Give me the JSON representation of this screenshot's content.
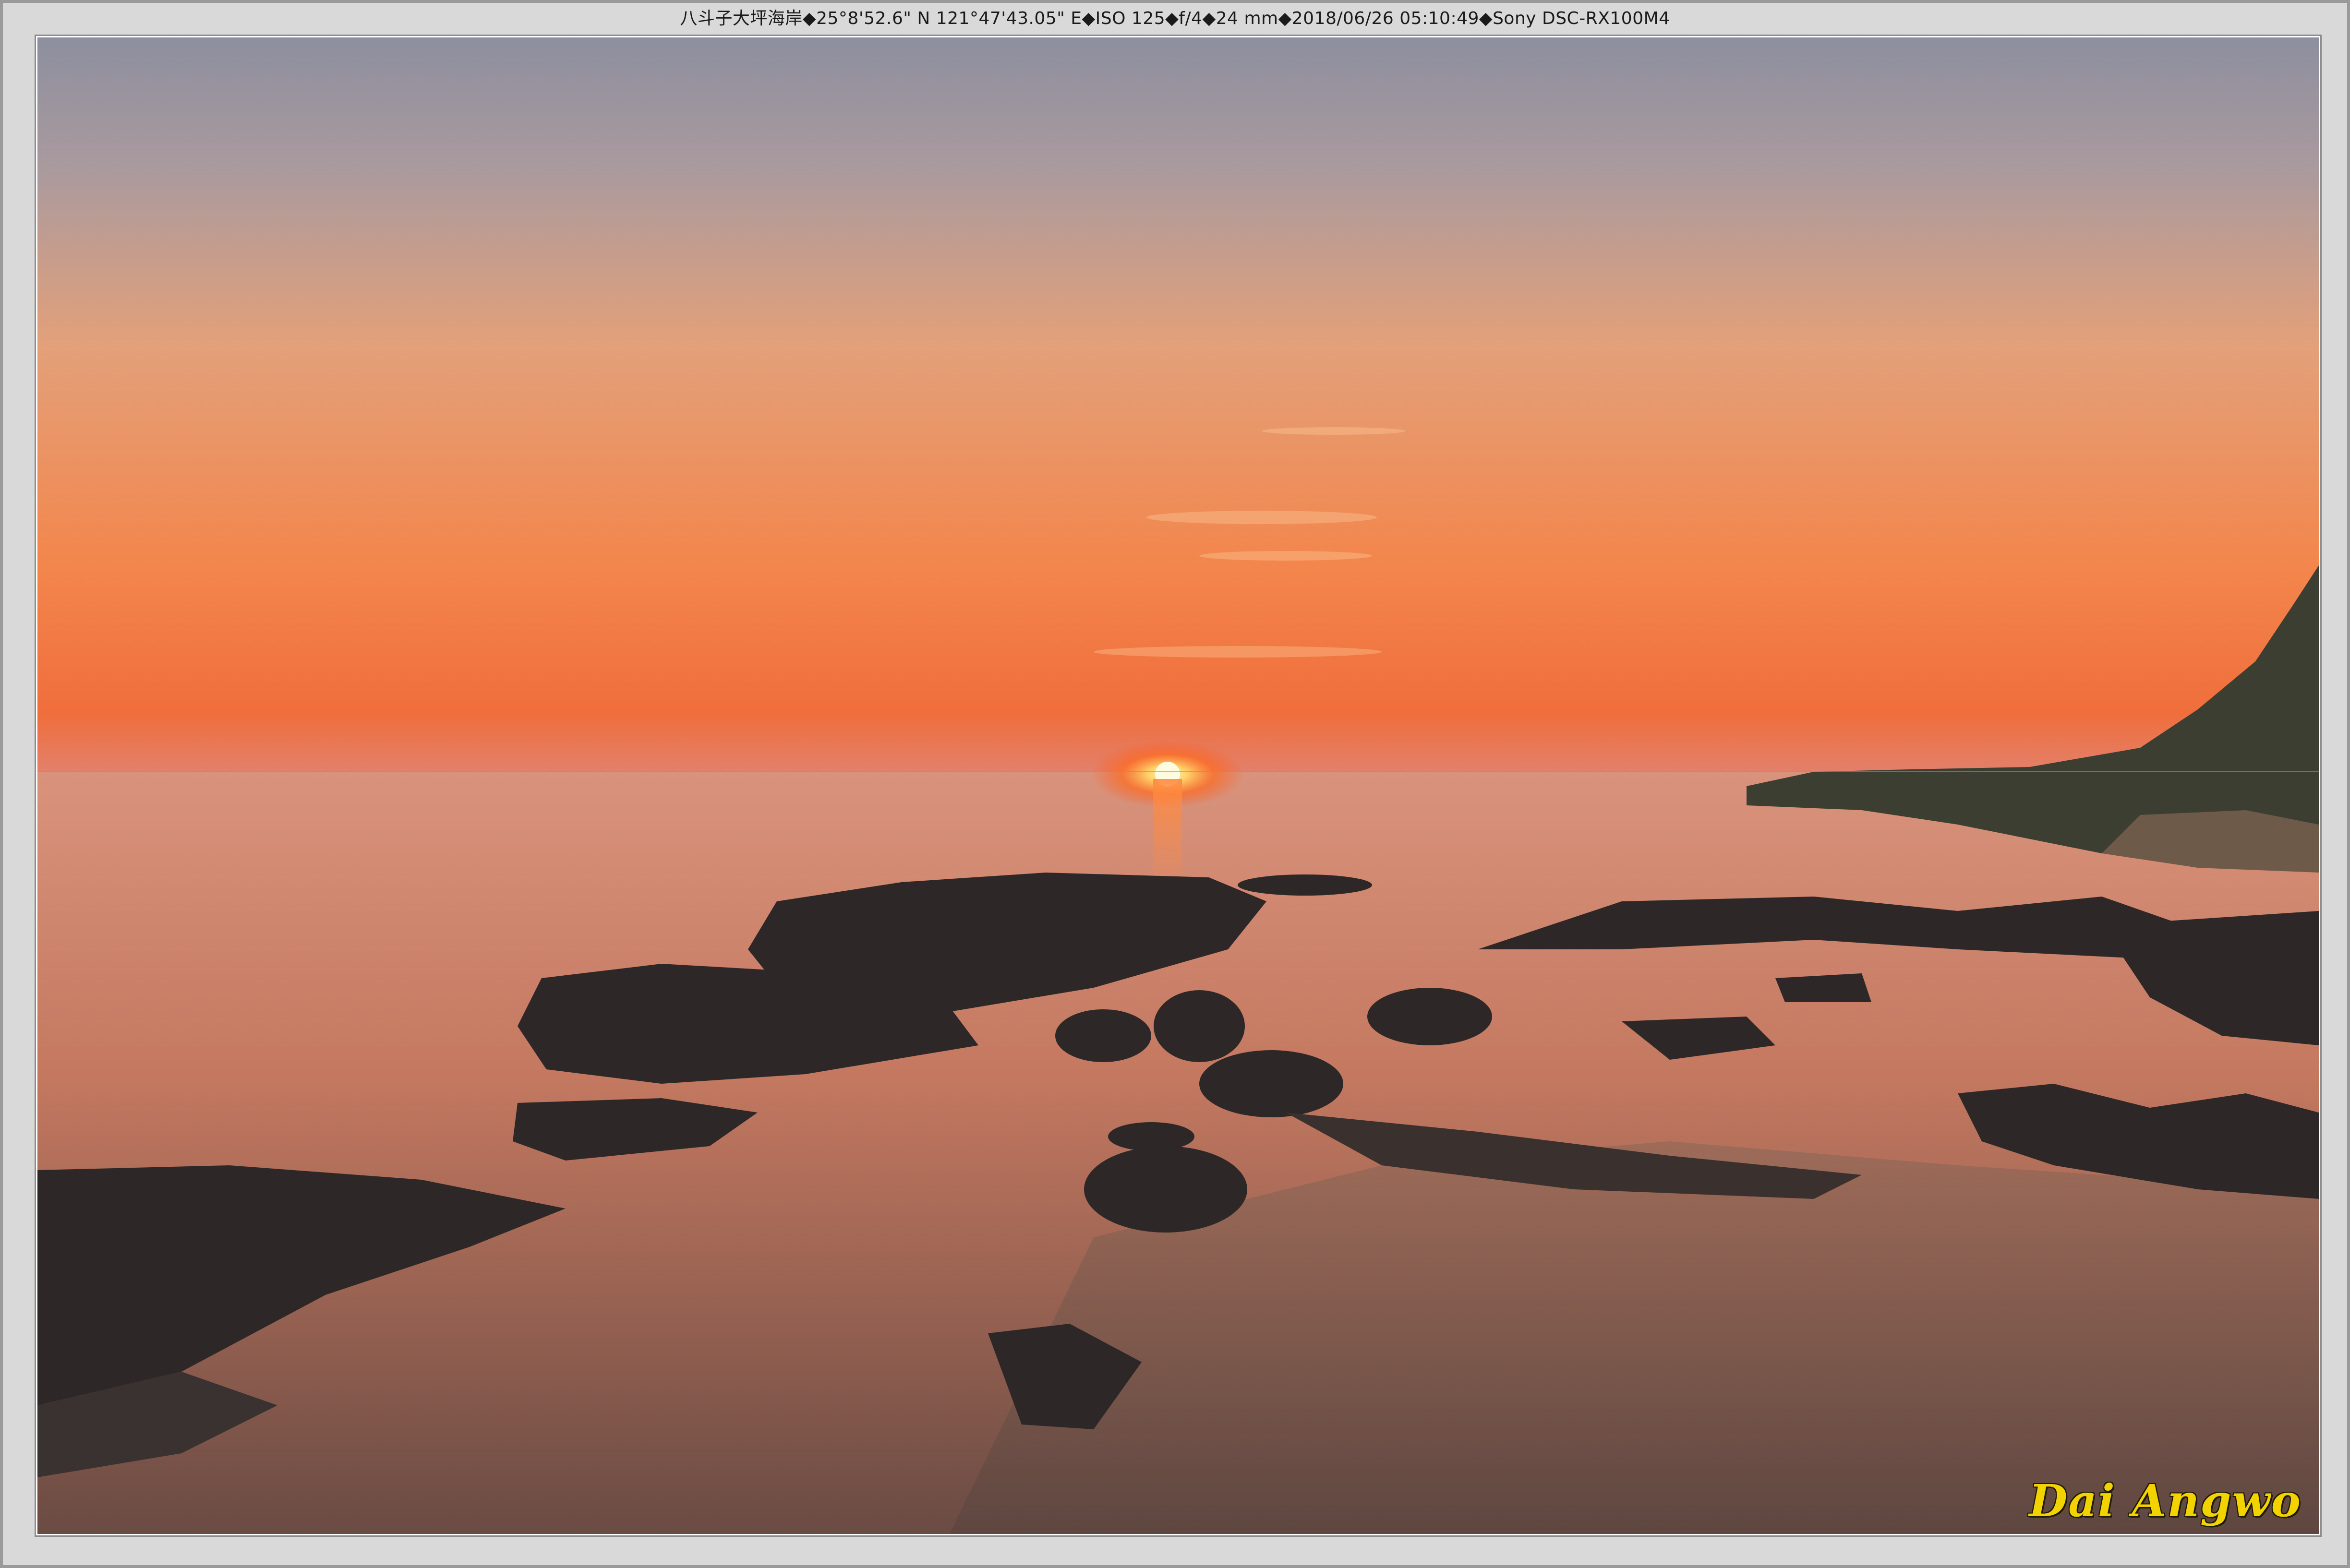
{
  "caption": {
    "text": "八斗子大坪海岸◆25°8'52.6\" N 121°47'43.05\" E◆ISO 125◆f/4◆24 mm◆2018/06/26 05:10:49◆Sony DSC-RX100M4"
  },
  "photo": {
    "scene": "sunset-over-rocky-coast",
    "colors": {
      "sky_top": "#8e8e9e",
      "sky_mid": "#e8a070",
      "sky_horizon": "#ff6a30",
      "sun": "#fff6c8",
      "sea": "#d88a6a",
      "rock": "#2e2a2a",
      "cliff": "#3d4434"
    }
  },
  "signature": {
    "text": "Dai Angwo",
    "color": "#f2d300"
  }
}
